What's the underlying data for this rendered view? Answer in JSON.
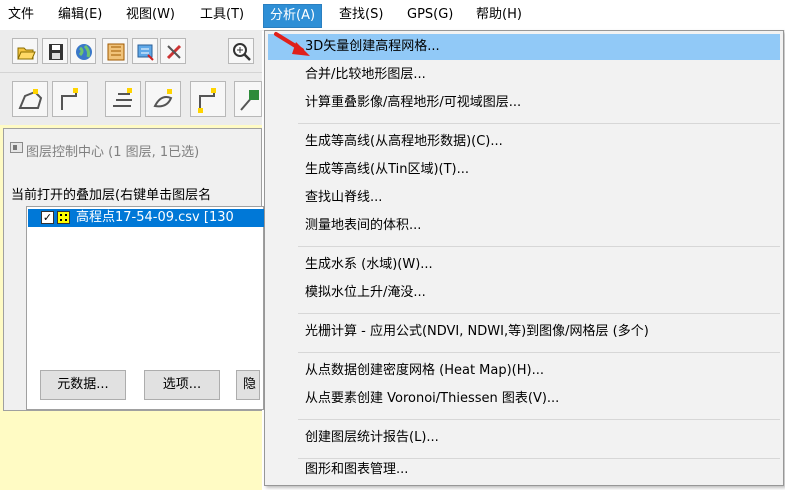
{
  "menubar": {
    "items": [
      "文件",
      "编辑(E)",
      "视图(W)",
      "工具(T)",
      "分析(A)",
      "查找(S)",
      "GPS(G)",
      "帮助(H)"
    ]
  },
  "toolbar": {
    "row1_icons": [
      "open-folder-icon",
      "save-icon",
      "globe-icon",
      "map-icon",
      "layers-icon",
      "tools-icon",
      "zoom-in-icon"
    ],
    "row2_icons": [
      "draw-area-icon",
      "draw-line-icon",
      "draw-polyline-icon",
      "draw-shape-icon",
      "draw-vertex-icon",
      "draw-3d-icon"
    ]
  },
  "layer_panel": {
    "title": "图层控制中心 (1 图层, 1已选)",
    "description": "当前打开的叠加层(右键单击图层名",
    "layers": [
      {
        "name": "高程点17-54-09.csv [130",
        "checked": true
      }
    ],
    "buttons": [
      "元数据...",
      "选项...",
      "隐"
    ]
  },
  "analysis_menu": {
    "items": [
      "3D矢量创建高程网格...",
      "合并/比较地形图层...",
      "计算重叠影像/高程地形/可视域图层...",
      "生成等高线(从高程地形数据)(C)...",
      "生成等高线(从Tin区域)(T)...",
      "查找山脊线...",
      "测量地表间的体积...",
      "生成水系 (水域)(W)...",
      "模拟水位上升/淹没...",
      "光栅计算 - 应用公式(NDVI, NDWI,等)到图像/网格层 (多个)",
      "从点数据创建密度网格 (Heat Map)(H)...",
      "从点要素创建 Voronoi/Thiessen 图表(V)...",
      "创建图层统计报告(L)...",
      "图形和图表管理..."
    ]
  },
  "colors": {
    "active_menu": "#2e8fd6",
    "highlight_item": "#91c9f7",
    "selected_layer": "#0078d7",
    "background_yellow": "#fffbc4",
    "arrow": "#e0201b"
  }
}
